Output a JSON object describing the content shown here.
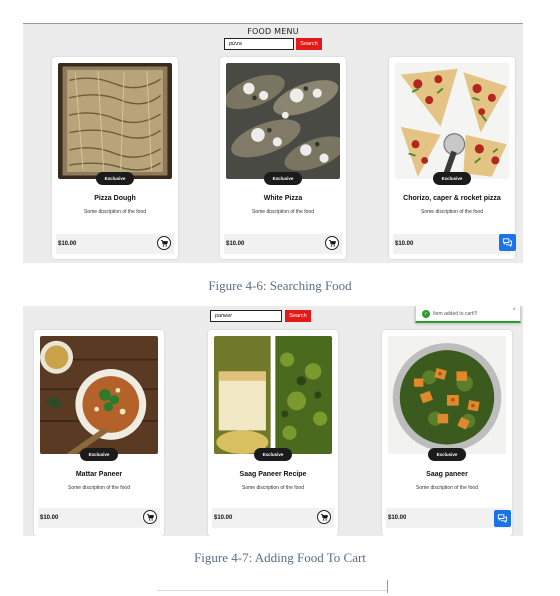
{
  "figure1": {
    "menu_title": "FOOD MENU",
    "search_value": "pizza",
    "search_button": "Search",
    "caption": "Figure 4-6: Searching Food",
    "cards": [
      {
        "badge": "Exclusive",
        "name": "Pizza Dough",
        "description": "Some discription of the food",
        "price": "$10.00",
        "action_icon": "cart-icon"
      },
      {
        "badge": "Exclusive",
        "name": "White Pizza",
        "description": "Some discription of the food",
        "price": "$10.00",
        "action_icon": "cart-icon"
      },
      {
        "badge": "Exclusive",
        "name": "Chorizo, caper & rocket pizza",
        "description": "Some discription of the food",
        "price": "$10.00",
        "action_icon": "chat-icon"
      }
    ]
  },
  "figure2": {
    "search_value": "paneer",
    "search_button": "Search",
    "toast": "Item added to cart!!!",
    "toast_close": "×",
    "caption": "Figure 4-7: Adding Food To Cart",
    "cards": [
      {
        "badge": "Exclusive",
        "name": "Mattar Paneer",
        "description": "Some discription of the food",
        "price": "$10.00",
        "action_icon": "cart-icon"
      },
      {
        "badge": "Exclusive",
        "name": "Saag Paneer Recipe",
        "description": "Some discription of the food",
        "price": "$10.00",
        "action_icon": "cart-icon"
      },
      {
        "badge": "Exclusive",
        "name": "Saag paneer",
        "description": "Some discription of the food",
        "price": "$10.00",
        "action_icon": "chat-icon"
      }
    ]
  },
  "colors": {
    "accent_red": "#e41a1a",
    "chat_blue": "#1a73e8",
    "success_green": "#2a9d2a",
    "badge_dark": "#1b1b1b"
  }
}
